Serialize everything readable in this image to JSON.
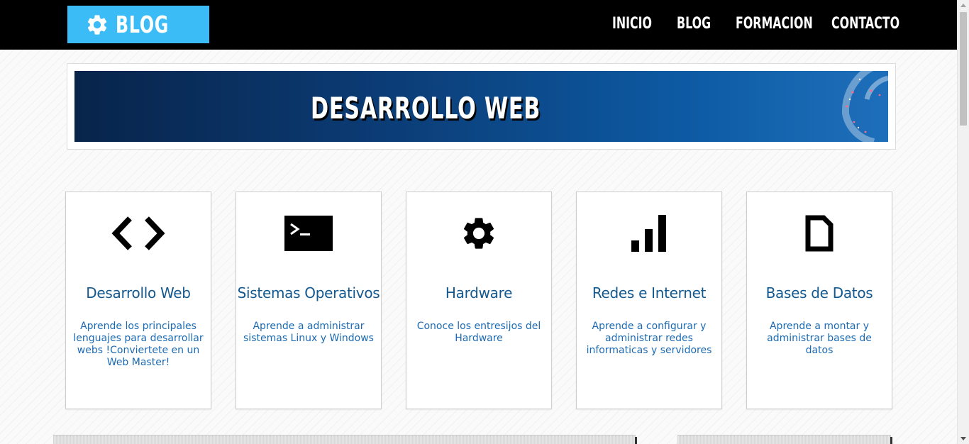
{
  "header": {
    "logo_text": "BLOG",
    "logo_icon": "gear-icon",
    "nav": [
      {
        "label": "INICIO"
      },
      {
        "label": "BLOG"
      },
      {
        "label": "FORMACION"
      },
      {
        "label": "CONTACTO"
      }
    ]
  },
  "banner": {
    "title": "DESARROLLO WEB"
  },
  "cards": [
    {
      "icon": "code-icon",
      "title": "Desarrollo Web",
      "description": "Aprende los principales lenguajes para desarrollar webs !Conviertete en un Web Master!"
    },
    {
      "icon": "terminal-icon",
      "title": "Sistemas Operativos",
      "description": "Aprende a administrar sistemas Linux y Windows"
    },
    {
      "icon": "gear-icon",
      "title": "Hardware",
      "description": "Conoce los entresijos del Hardware"
    },
    {
      "icon": "signal-bars-icon",
      "title": "Redes e Internet",
      "description": "Aprende a configurar y administrar redes informaticas y servidores"
    },
    {
      "icon": "document-icon",
      "title": "Bases de Datos",
      "description": "Aprende a montar y administrar bases de datos"
    }
  ],
  "colors": {
    "logo_bg": "#3bbcf6",
    "topbar_bg": "#000000",
    "card_title": "#13598f",
    "card_text": "#1b6ab3"
  }
}
